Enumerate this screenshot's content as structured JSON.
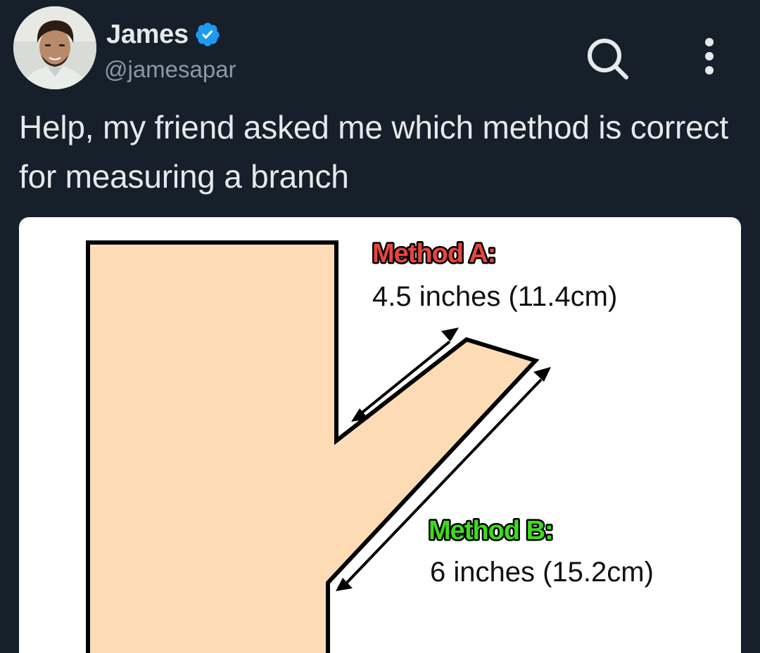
{
  "author": {
    "display_name": "James",
    "handle": "@jamesapar",
    "verified_icon": "verified-badge-icon",
    "avatar_icon": "profile-photo"
  },
  "header_actions": {
    "search_icon": "search-icon",
    "more_icon": "more-vertical-icon"
  },
  "tweet": {
    "text": "Help, my friend asked me which method is correct for measuring a branch"
  },
  "media": {
    "method_a": {
      "label": "Method A:",
      "measurement": "4.5 inches (11.4cm)",
      "color": "#e8453c"
    },
    "method_b": {
      "label": "Method B:",
      "measurement": "6 inches (15.2cm)",
      "color": "#3ddc1c"
    },
    "tree_fill": "#fddcb5"
  },
  "colors": {
    "background": "#15202b",
    "text_primary": "#e7e9ea",
    "text_secondary": "#8b98a5",
    "verified_blue": "#1d9bf0"
  }
}
